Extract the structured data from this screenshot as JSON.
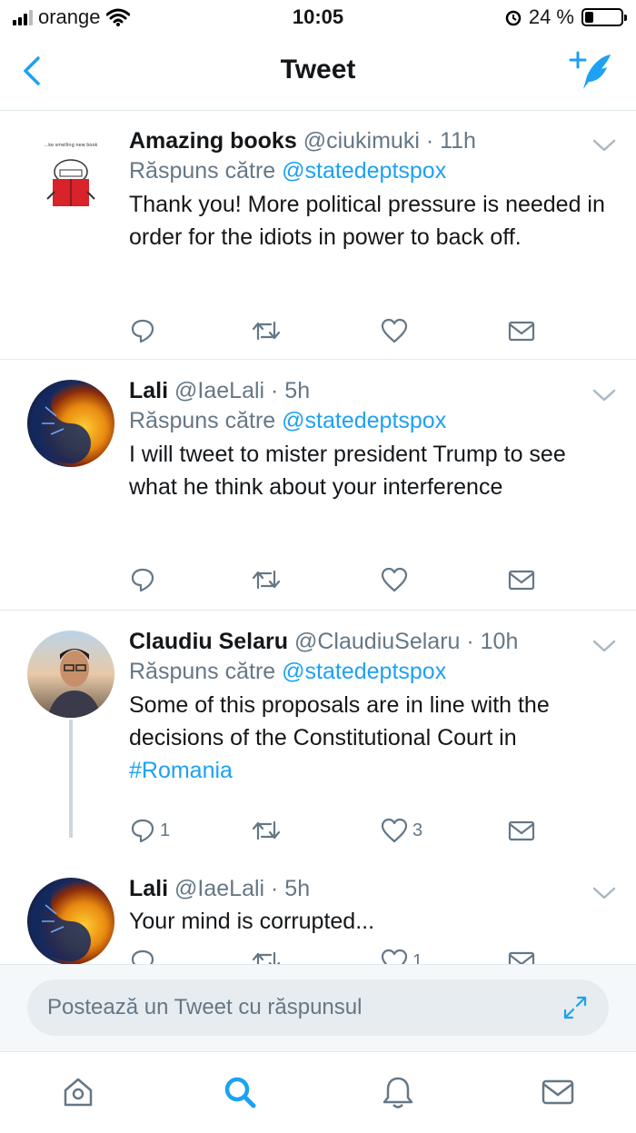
{
  "status_bar": {
    "carrier": "orange",
    "time": "10:05",
    "battery": "24 %",
    "battery_level": 0.24
  },
  "nav": {
    "title": "Tweet"
  },
  "tweets": [
    {
      "name": "Amazing books",
      "handle": "@ciukimuki · 11h",
      "reply_prefix": "Răspuns către",
      "reply_mention": "@statedeptspox",
      "text": "Thank you! More political pressure is needed in order for the idiots in power to back off.",
      "avatar_caption": "...ke smelling new book"
    },
    {
      "name": "Lali",
      "handle": "@IaeLali · 5h",
      "reply_prefix": "Răspuns către",
      "reply_mention": "@statedeptspox",
      "text": "I will tweet to mister president Trump to see what he think about your interference"
    },
    {
      "name": "Claudiu Selaru",
      "handle": "@ClaudiuSelaru · 10h",
      "reply_prefix": "Răspuns către",
      "reply_mention": "@statedeptspox",
      "text": "Some of this proposals are in line with the decisions of the Constitutional Court in ",
      "hashtag": "#Romania",
      "reply_count": "1",
      "like_count": "3"
    },
    {
      "name": "Lali",
      "handle": "@IaeLali · 5h",
      "text": "Your mind is corrupted...",
      "like_count": "1"
    }
  ],
  "composer": {
    "placeholder": "Postează un Tweet cu răspunsul"
  },
  "tabs": [
    "home-icon",
    "search-icon",
    "notifications-icon",
    "messages-icon"
  ],
  "colors": {
    "accent": "#1da1f2",
    "secondary_text": "#657786",
    "divider": "#e1e8ed"
  }
}
